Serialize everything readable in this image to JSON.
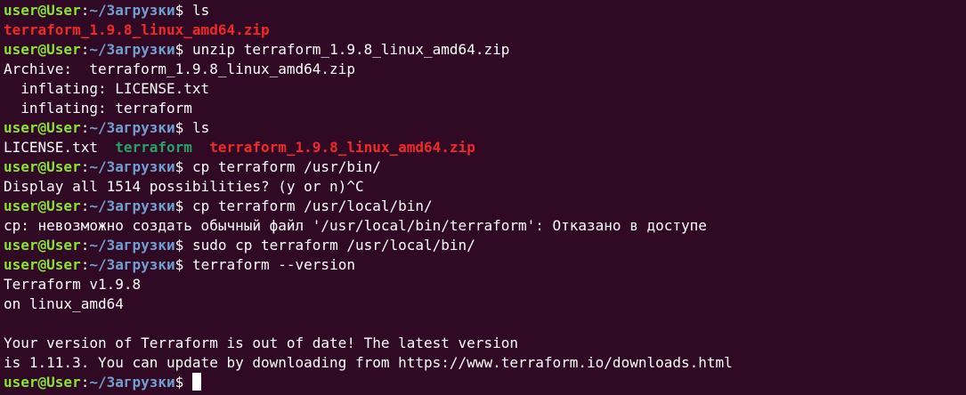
{
  "prompt": {
    "user": "user@User",
    "colon": ":",
    "path": "~/Загрузки",
    "symbol": "$ "
  },
  "colors": {
    "background": "#300a24",
    "user": "#8ae234",
    "path": "#729fcf",
    "archive": "#ef2929",
    "executable": "#26a269",
    "text": "#ffffff"
  },
  "lines": {
    "cmd_ls_1": "ls",
    "ls1_zip": "terraform_1.9.8_linux_amd64.zip",
    "cmd_unzip": "unzip terraform_1.9.8_linux_amd64.zip",
    "archive_line": "Archive:  terraform_1.9.8_linux_amd64.zip",
    "inflating_license": "  inflating: LICENSE.txt",
    "inflating_terraform": "  inflating: terraform",
    "cmd_ls_2": "ls",
    "ls2_license": "LICENSE.txt",
    "ls2_sep1": "  ",
    "ls2_terraform": "terraform",
    "ls2_sep2": "  ",
    "ls2_zip": "terraform_1.9.8_linux_amd64.zip",
    "cmd_cp_bin": "cp terraform /usr/bin/",
    "display_possibilities": "Display all 1514 possibilities? (y or n)^C",
    "cmd_cp_local": "cp terraform /usr/local/bin/",
    "cp_error": "cp: невозможно создать обычный файл '/usr/local/bin/terraform': Отказано в доступе",
    "cmd_sudo_cp": "sudo cp terraform /usr/local/bin/",
    "cmd_version": "terraform --version",
    "version_out": "Terraform v1.9.8",
    "platform_out": "on linux_amd64",
    "blank": "",
    "outdated_1": "Your version of Terraform is out of date! The latest version",
    "outdated_2": "is 1.11.3. You can update by downloading from https://www.terraform.io/downloads.html"
  }
}
